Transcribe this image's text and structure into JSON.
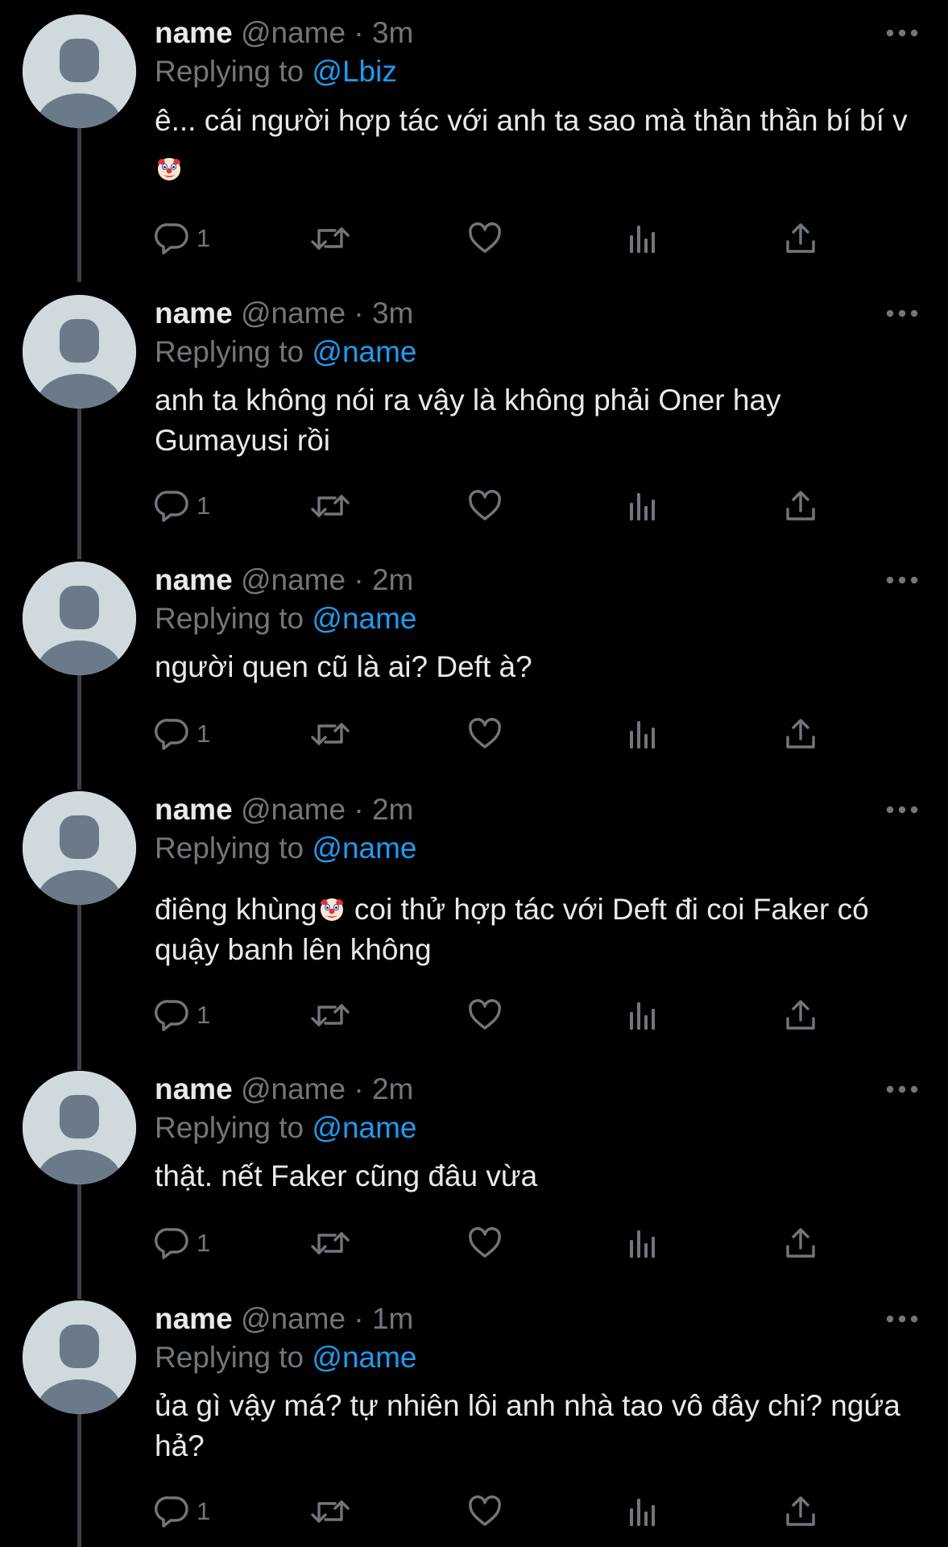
{
  "tweets": [
    {
      "name": "name",
      "handle": "@name",
      "sep": "·",
      "time": "3m",
      "replying_prefix": "Replying to",
      "replying_to": "@Lbiz",
      "text_parts": [
        "ê... cái người hợp tác với anh ta sao mà thần thần bí bí v",
        ""
      ],
      "reply_count": "1"
    },
    {
      "name": "name",
      "handle": "@name",
      "sep": "·",
      "time": "3m",
      "replying_prefix": "Replying to",
      "replying_to": "@name",
      "text_parts": [
        "anh ta không nói ra vậy là không phải Oner hay Gumayusi rồi"
      ],
      "reply_count": "1"
    },
    {
      "name": "name",
      "handle": "@name",
      "sep": "·",
      "time": "2m",
      "replying_prefix": "Replying to",
      "replying_to": "@name",
      "text_parts": [
        "người quen cũ là ai? Deft à?"
      ],
      "reply_count": "1"
    },
    {
      "name": "name",
      "handle": "@name",
      "sep": "·",
      "time": "2m",
      "replying_prefix": "Replying to",
      "replying_to": "@name",
      "text_parts": [
        "điêng khùng",
        "  coi thử hợp tác với Deft đi coi Faker có quậy banh lên không"
      ],
      "reply_count": "1"
    },
    {
      "name": "name",
      "handle": "@name",
      "sep": "·",
      "time": "2m",
      "replying_prefix": "Replying to",
      "replying_to": "@name",
      "text_parts": [
        "thật. nết Faker cũng đâu vừa"
      ],
      "reply_count": "1"
    },
    {
      "name": "name",
      "handle": "@name",
      "sep": "·",
      "time": "1m",
      "replying_prefix": "Replying to",
      "replying_to": "@name",
      "text_parts": [
        "ủa gì vậy má? tự nhiên lôi anh nhà tao vô đây chi? ngứa hả?"
      ],
      "reply_count": "1"
    }
  ],
  "icons": {
    "avatar": "default-avatar-icon",
    "more": "more-dots-icon",
    "reply": "reply-bubble-icon",
    "retweet": "retweet-icon",
    "like": "heart-icon",
    "views": "views-bar-icon",
    "share": "share-icon",
    "emoji": "clown-face-emoji"
  },
  "colors": {
    "background": "#000000",
    "text": "#e7e9ea",
    "muted": "#71767b",
    "link": "#1d9bf0",
    "thread_line": "#3b4046",
    "avatar_bg": "#cfd9de",
    "avatar_fg": "#6b7a88"
  }
}
